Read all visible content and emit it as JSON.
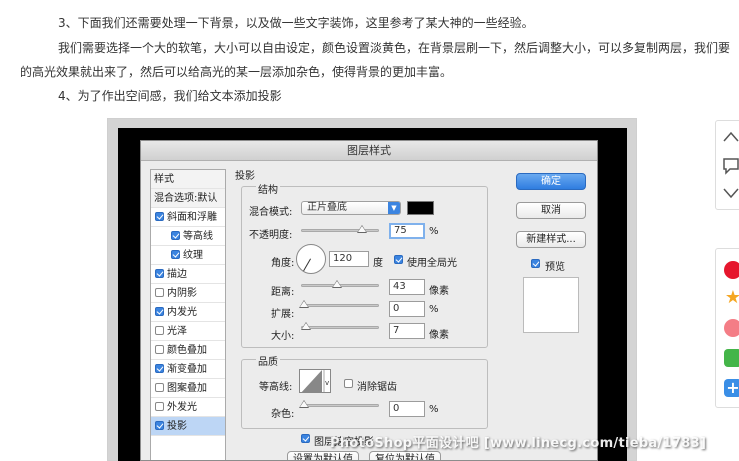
{
  "article": {
    "para1": "3、下面我们还需要处理一下背景，以及做一些文字装饰，这里参考了某大神的一些经验。",
    "para2_line1": "我们需要选择一个大的软笔，大小可以自由设定，颜色设置淡黄色，在背景层刷一下，然后调整大小，可以多复制两层，我们要",
    "para2_line2": "的高光效果就出来了，然后可以给高光的某一层添加杂色，使得背景的更加丰富。",
    "para3": "4、为了作出空间感，我们给文本添加投影"
  },
  "dialog": {
    "title": "图层样式",
    "sidebar": {
      "header": "样式",
      "blend_options": "混合选项:默认",
      "items": [
        {
          "label": "斜面和浮雕",
          "checked": true,
          "indent": false
        },
        {
          "label": "等高线",
          "checked": true,
          "indent": true
        },
        {
          "label": "纹理",
          "checked": true,
          "indent": true
        },
        {
          "label": "描边",
          "checked": true,
          "indent": false
        },
        {
          "label": "内阴影",
          "checked": false,
          "indent": false
        },
        {
          "label": "内发光",
          "checked": true,
          "indent": false
        },
        {
          "label": "光泽",
          "checked": false,
          "indent": false
        },
        {
          "label": "颜色叠加",
          "checked": false,
          "indent": false
        },
        {
          "label": "渐变叠加",
          "checked": true,
          "indent": false
        },
        {
          "label": "图案叠加",
          "checked": false,
          "indent": false
        },
        {
          "label": "外发光",
          "checked": false,
          "indent": false
        },
        {
          "label": "投影",
          "checked": true,
          "indent": false,
          "selected": true
        }
      ]
    },
    "section_title": "投影",
    "structure_title": "结构",
    "blend_mode_label": "混合模式:",
    "blend_mode_value": "正片叠底",
    "shadow_color": "#000000",
    "opacity_label": "不透明度:",
    "opacity_value": "75",
    "percent": "%",
    "angle_label": "角度:",
    "angle_value": "120",
    "degree_unit": "度",
    "global_light_label": "使用全局光",
    "distance_label": "距离:",
    "distance_value": "43",
    "spread_label": "扩展:",
    "spread_value": "0",
    "size_label": "大小:",
    "size_value": "7",
    "pixel_unit": "像素",
    "quality_title": "品质",
    "contour_label": "等高线:",
    "antialias_label": "消除锯齿",
    "noise_label": "杂色:",
    "noise_value": "0",
    "knockout_label": "图层挖空投影",
    "set_default": "设置为默认值",
    "reset_default": "复位为默认值",
    "ok": "确定",
    "cancel": "取消",
    "new_style": "新建样式...",
    "preview_label": "预览"
  },
  "watermark": "PhotoShop平面设计吧 [www.linecg.com/tieba/1783]",
  "colors": {
    "accent": "#3b84e0",
    "selected_row": "#bdd6f5"
  }
}
